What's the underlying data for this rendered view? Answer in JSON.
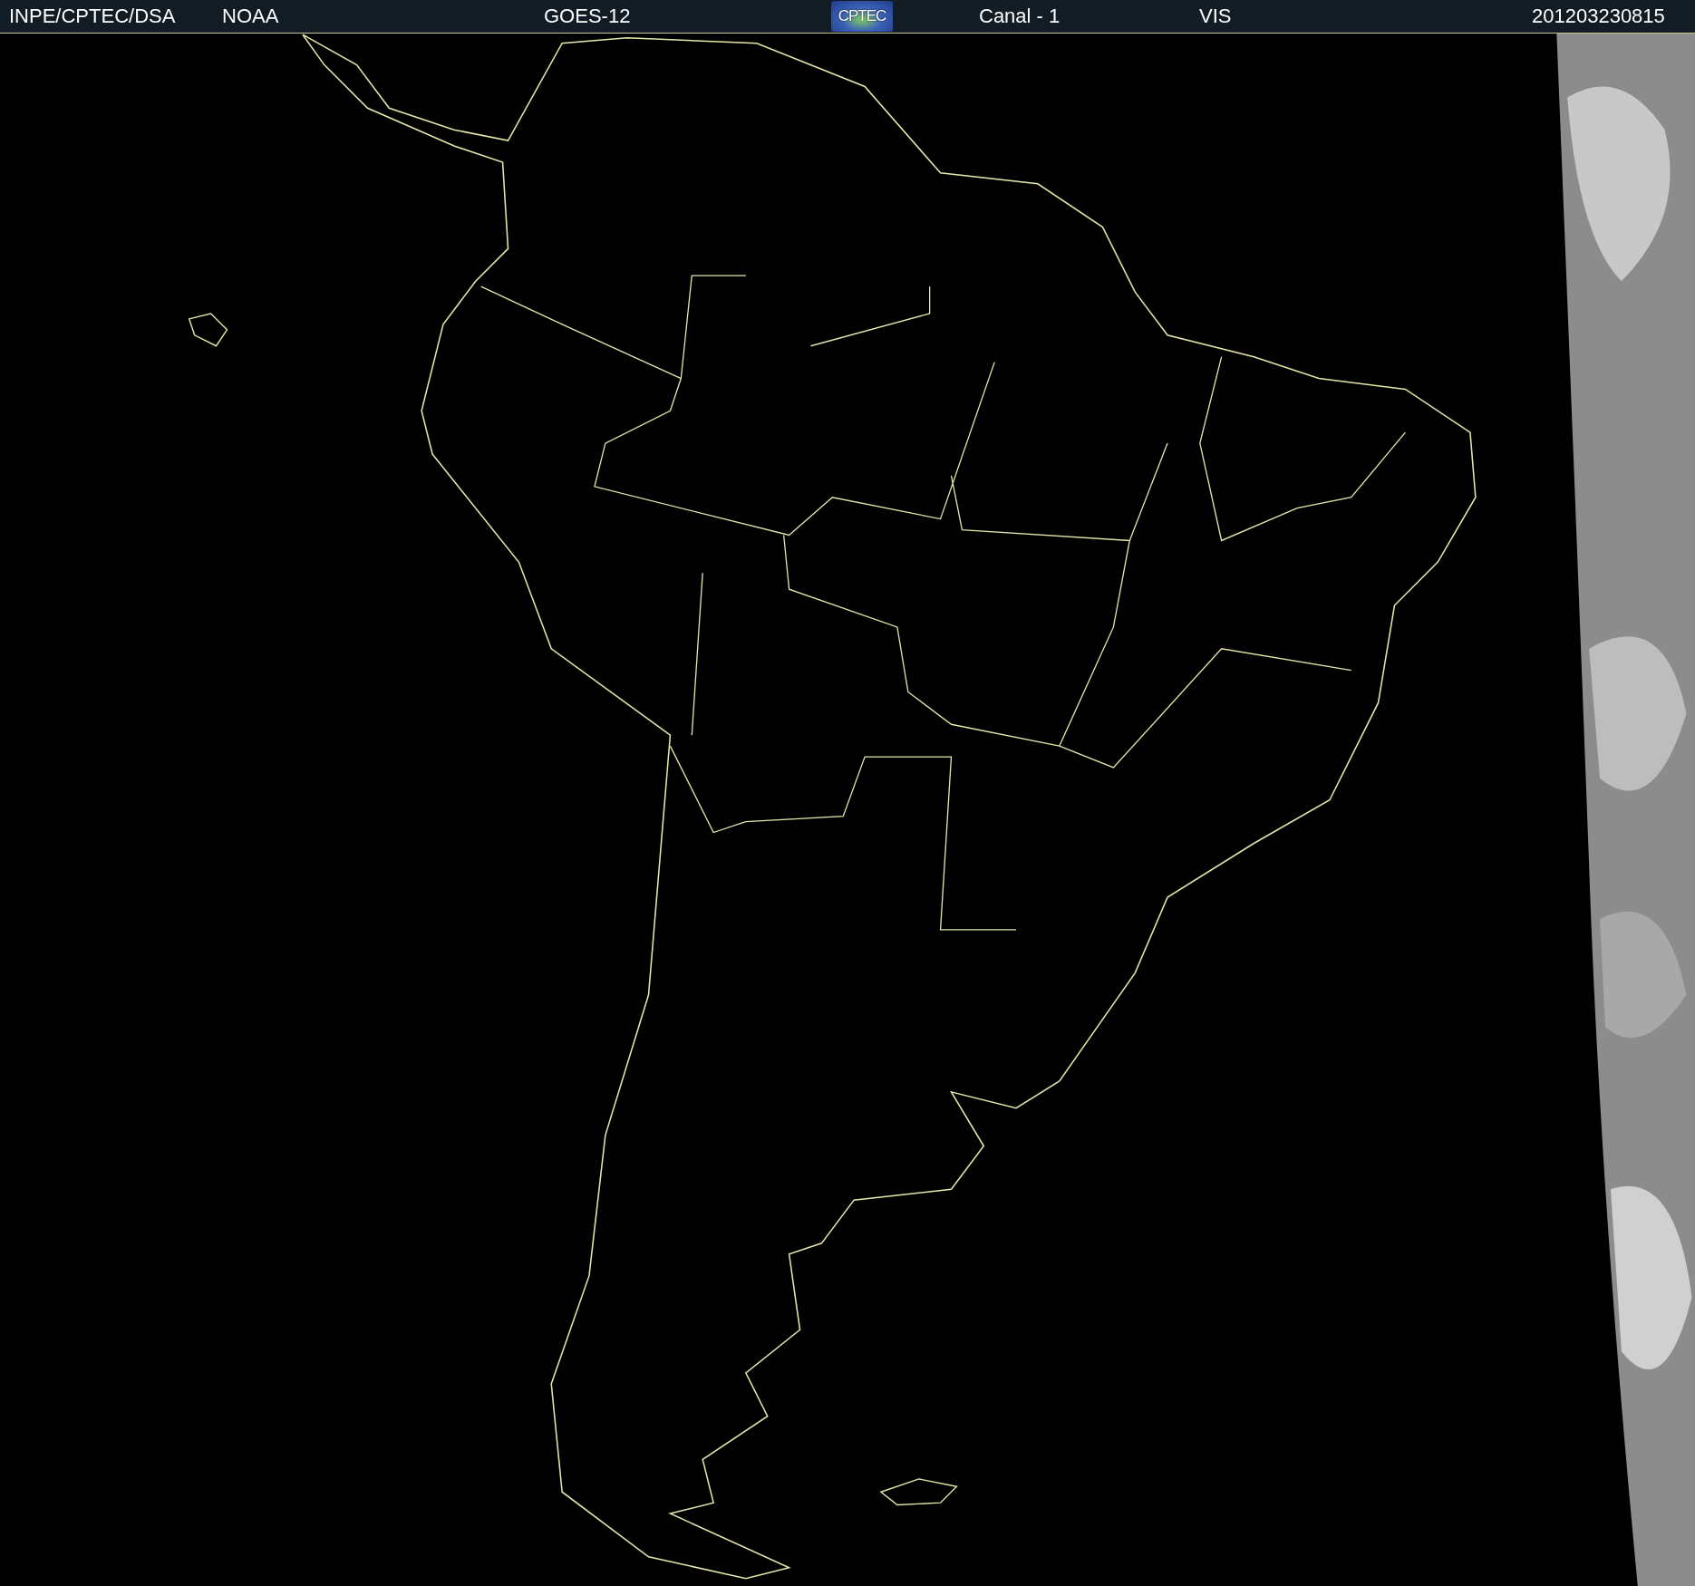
{
  "header": {
    "items": [
      {
        "kind": "text",
        "text": "INPE/CPTEC/DSA"
      },
      {
        "kind": "text",
        "text": "NOAA"
      },
      {
        "kind": "text",
        "text": "GOES-12"
      },
      {
        "kind": "logo",
        "text": "CPTEC"
      },
      {
        "kind": "text",
        "text": "Canal - 1"
      },
      {
        "kind": "text",
        "text": "VIS"
      },
      {
        "kind": "text",
        "text": "201203230815"
      }
    ]
  }
}
